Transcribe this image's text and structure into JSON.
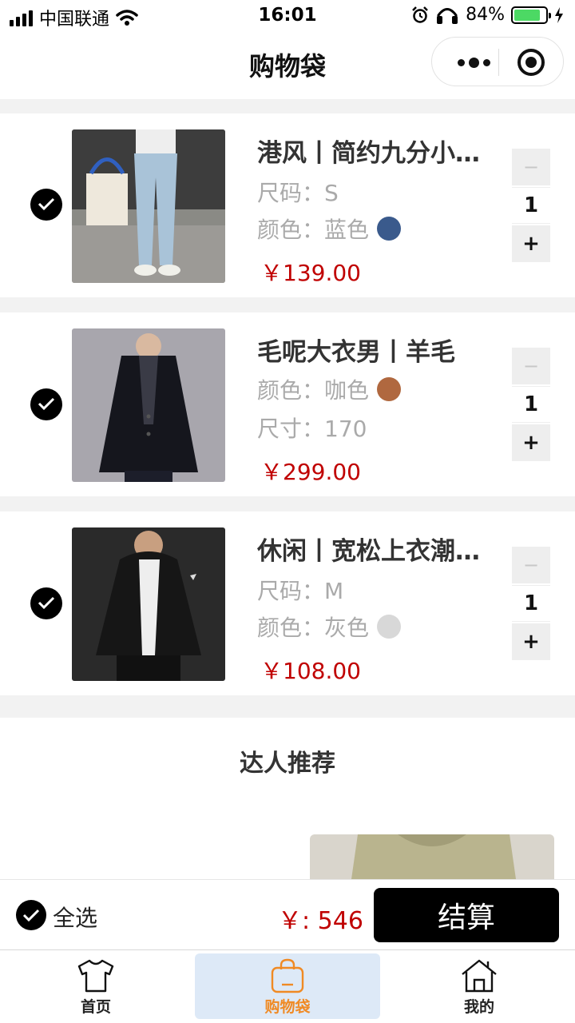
{
  "status_bar": {
    "carrier": "中国联通",
    "time": "16:01",
    "battery": "84%",
    "battery_level": 0.84
  },
  "nav": {
    "title": "购物袋"
  },
  "cart_items": [
    {
      "name": "港风丨简约九分小脚牛仔裤",
      "attr1": "尺码：S",
      "attr2": "颜色：蓝色",
      "swatch_color": "#3a5a8c",
      "price": "￥139.00",
      "qty": "1",
      "minus": "−",
      "plus": "+",
      "checked": true
    },
    {
      "name": "毛呢大衣男丨羊毛",
      "attr1": "颜色：咖色",
      "attr2": "尺寸：170",
      "swatch_color": "#b0683f",
      "price": "￥299.00",
      "qty": "1",
      "minus": "−",
      "plus": "+",
      "checked": true
    },
    {
      "name": "休闲丨宽松上衣潮流夹克",
      "attr1": "尺码：M",
      "attr2": "颜色：灰色",
      "swatch_color": "#d8d8d8",
      "price": "￥108.00",
      "qty": "1",
      "minus": "−",
      "plus": "+",
      "checked": true
    }
  ],
  "recommend": {
    "title": "达人推荐"
  },
  "checkout": {
    "select_all": "全选",
    "total": "￥: 546",
    "button": "结算"
  },
  "tabs": [
    {
      "label": "首页",
      "icon": "tshirt-icon"
    },
    {
      "label": "购物袋",
      "icon": "shopping-bag-icon",
      "active": true
    },
    {
      "label": "我的",
      "icon": "home-icon"
    }
  ],
  "colors": {
    "price": "#c00000",
    "active_tab_text": "#f08a24",
    "active_tab_bg": "#dde9f7",
    "battery": "#4cd964"
  }
}
